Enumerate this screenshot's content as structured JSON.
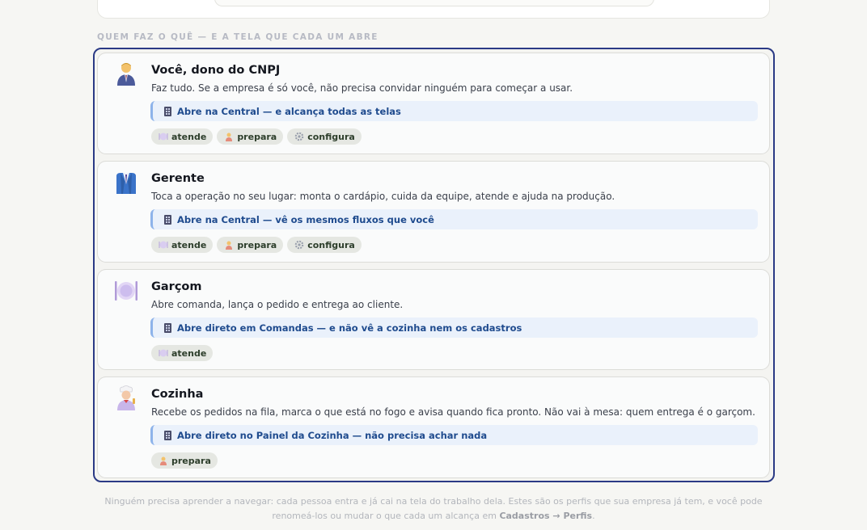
{
  "section_heading": "QUEM FAZ O QUÊ — E A TELA QUE CADA UM ABRE",
  "profiles": [
    {
      "title": "Você, dono do CNPJ",
      "icon": "business-person-icon",
      "description": "Faz tudo. Se a empresa é só você, não precisa convidar ninguém para começar a usar.",
      "callout": "Abre na Central — e alcança todas as telas",
      "chips": [
        "atende",
        "prepara",
        "configura"
      ]
    },
    {
      "title": "Gerente",
      "icon": "suit-icon",
      "description": "Toca a operação no seu lugar: monta o cardápio, cuida da equipe, atende e ajuda na produção.",
      "callout": "Abre na Central — vê os mesmos fluxos que você",
      "chips": [
        "atende",
        "prepara",
        "configura"
      ]
    },
    {
      "title": "Garçom",
      "icon": "plate-cutlery-icon",
      "description": "Abre comanda, lança o pedido e entrega ao cliente.",
      "callout": "Abre direto em Comandas — e não vê a cozinha nem os cadastros",
      "chips": [
        "atende"
      ]
    },
    {
      "title": "Cozinha",
      "icon": "cook-icon",
      "description": "Recebe os pedidos na fila, marca o que está no fogo e avisa quando fica pronto. Não vai à mesa: quem entrega é o garçom.",
      "callout": "Abre direto no Painel da Cozinha — não precisa achar nada",
      "chips": [
        "prepara"
      ]
    }
  ],
  "footer": {
    "text": "Ninguém precisa aprender a navegar: cada pessoa entra e já cai na tela do trabalho dela. Estes são os perfis que sua empresa já tem, e você pode renomeá-los ou mudar o que cada um alcança em",
    "link": "Cadastros → Perfis",
    "end": "."
  },
  "colors": {
    "frame_border": "#2b3a85",
    "callout_bg": "#eaf1fb",
    "callout_text": "#1f4b8e",
    "chip_bg": "#e5e7e2"
  }
}
